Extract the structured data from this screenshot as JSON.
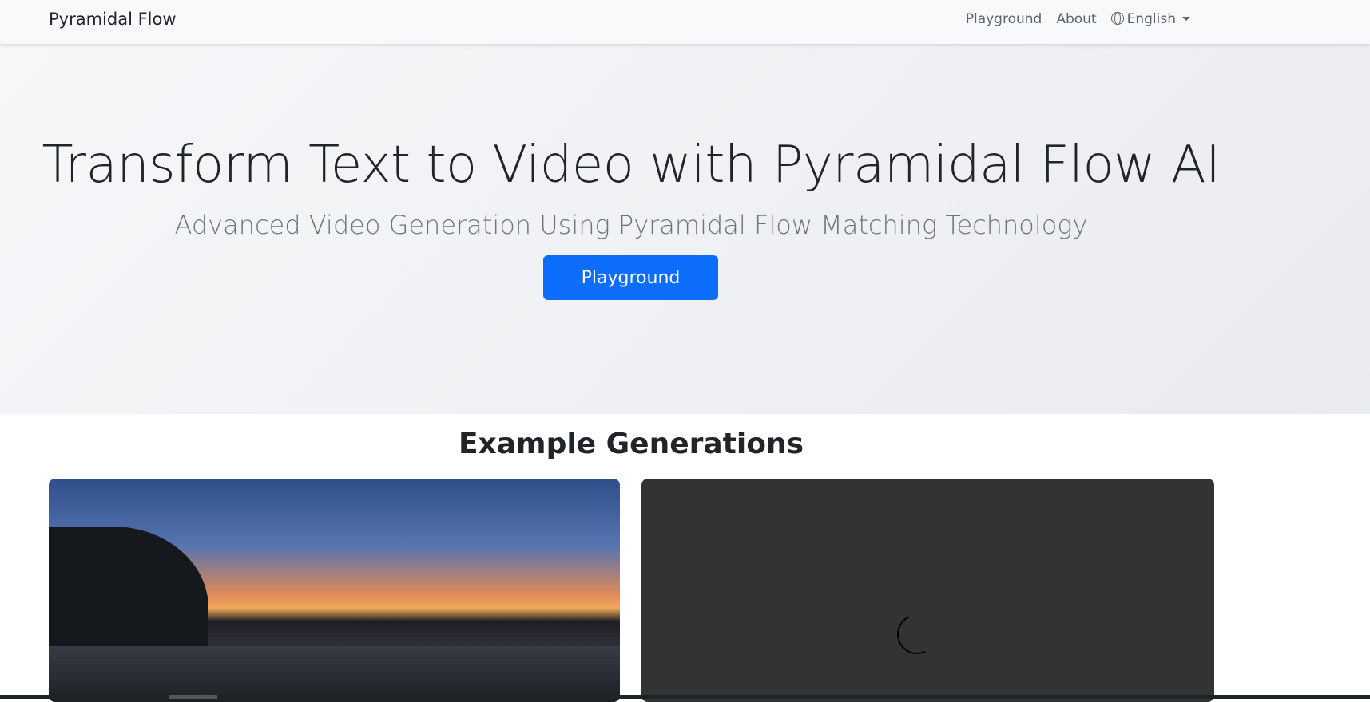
{
  "navbar": {
    "brand": "Pyramidal Flow",
    "links": [
      "Playground",
      "About"
    ],
    "language": "English"
  },
  "hero": {
    "title": "Transform Text to Video with Pyramidal Flow AI",
    "subtitle": "Advanced Video Generation Using Pyramidal Flow Matching Technology",
    "cta": "Playground"
  },
  "examples": {
    "heading": "Example Generations"
  }
}
